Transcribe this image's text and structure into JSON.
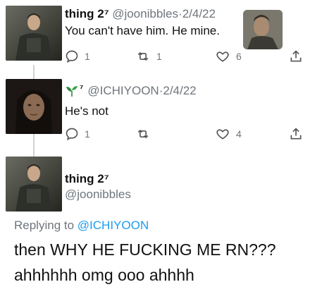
{
  "tweets": [
    {
      "display_name": "thing 2⁷",
      "handle": "@joonibbles",
      "date": "2/4/22",
      "text": "You can't have him. He mine.",
      "replies": "1",
      "retweets": "1",
      "likes": "6"
    },
    {
      "display_name": "⁷",
      "handle": "@ICHIYOON",
      "date": "2/4/22",
      "text": "He's not",
      "replies": "1",
      "retweets": "",
      "likes": "4"
    }
  ],
  "main_tweet": {
    "display_name": "thing 2⁷",
    "handle": "@joonibbles",
    "replying_label": "Replying to",
    "replying_handle": "@ICHIYOON",
    "text_line1": "then WHY HE FUCKING ME RN???",
    "text_line2": "ahhhhhh omg ooo ahhhh"
  },
  "separator": "·",
  "icons": [
    "reply-icon",
    "retweet-icon",
    "like-icon",
    "share-icon",
    "sprout-icon"
  ],
  "colors": {
    "link": "#1d9bf0",
    "muted": "#6e767d",
    "sprout": "#2e8b3a"
  }
}
